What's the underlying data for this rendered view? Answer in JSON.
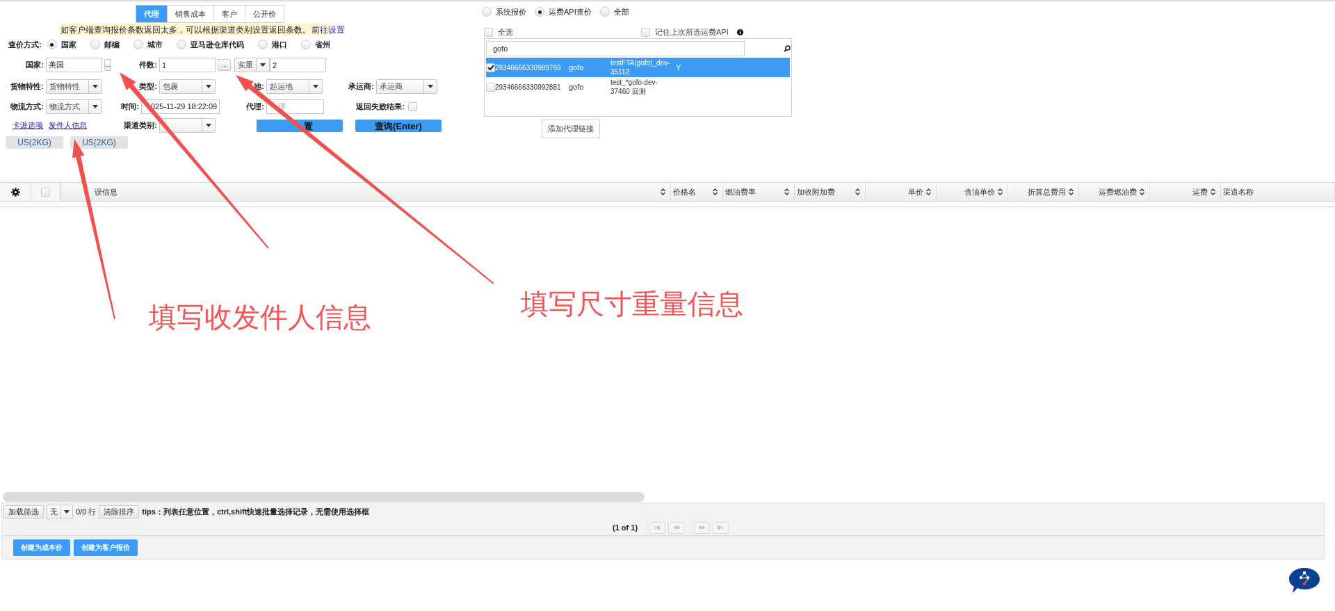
{
  "tabs": [
    {
      "label": "代理",
      "selected": true
    },
    {
      "label": "销售成本",
      "selected": false
    },
    {
      "label": "客户",
      "selected": false
    },
    {
      "label": "公开价",
      "selected": false
    }
  ],
  "notice": {
    "text": "如客户端查询报价条数返回太多，可以根据渠道类别设置返回条数。",
    "link": "前往设置"
  },
  "query_mode": {
    "label": "查价方式:",
    "options": [
      {
        "label": "国家",
        "selected": true
      },
      {
        "label": "邮编",
        "selected": false
      },
      {
        "label": "城市",
        "selected": false
      },
      {
        "label": "亚马逊仓库代码",
        "selected": false
      },
      {
        "label": "港口",
        "selected": false
      },
      {
        "label": "省州",
        "selected": false
      }
    ]
  },
  "form_rows": [
    [
      {
        "kind": "picker",
        "label": "国家:",
        "value": "美国",
        "button": "..."
      },
      {
        "kind": "picker",
        "label": "件数:",
        "value": "1",
        "button": "..."
      },
      {
        "kind": "select_input",
        "select": "实重",
        "value": "2"
      }
    ],
    [
      {
        "kind": "select",
        "label": "货物特性:",
        "value": "货物特性"
      },
      {
        "kind": "select",
        "label": "类型:",
        "value": "包裹"
      },
      {
        "kind": "select",
        "label": "地:",
        "value": "起运地"
      },
      {
        "kind": "select",
        "label": "承运商:",
        "value": "承运商"
      }
    ],
    [
      {
        "kind": "select",
        "label": "物流方式:",
        "value": "物流方式"
      },
      {
        "kind": "datetime",
        "label": "时间:",
        "value": "025-11-29 18:22:09"
      },
      {
        "kind": "input",
        "label": "代理:",
        "placeholder": "理"
      },
      {
        "kind": "checkbox",
        "label": "返回失败结果:",
        "checked": false
      }
    ],
    [
      {
        "kind": "links",
        "links": [
          "卡派选项",
          "发件人信息"
        ]
      },
      {
        "kind": "select",
        "label": "渠道类别:"
      },
      {
        "kind": "button",
        "label": "置"
      },
      {
        "kind": "button",
        "label": "查询(Enter)"
      }
    ]
  ],
  "chips": [
    "US(2KG)",
    "US(2KG)"
  ],
  "source_options": [
    {
      "label": "系统报价",
      "selected": false
    },
    {
      "label": "运费API查价",
      "selected": true
    },
    {
      "label": "全部",
      "selected": false
    }
  ],
  "select_all": {
    "label": "全选",
    "checked": false
  },
  "remember": {
    "label": "记住上次所选运费API",
    "checked": false
  },
  "api_search": {
    "value": "gofo"
  },
  "api_rows": [
    {
      "id": "29346666330989769",
      "name": "gofo",
      "channel": "testFTA(gofo)_dev-35112",
      "flag": "Y",
      "checked": true,
      "selected": true
    },
    {
      "id": "29346666330992881",
      "name": "gofo",
      "channel": "test_*gofo-dev-37460 回测",
      "checked": false,
      "selected": false
    }
  ],
  "add_button": "添加代理链接",
  "table": {
    "header_checkbox": {
      "checked": false
    },
    "columns": [
      {
        "label": "误信息"
      },
      {
        "label": "价格名"
      },
      {
        "label": "燃油费率"
      },
      {
        "label": "加收附加费"
      },
      {
        "label": "单价"
      },
      {
        "label": "含油单价"
      },
      {
        "label": "折算总费用"
      },
      {
        "label": "运费燃油费"
      },
      {
        "label": "运费"
      },
      {
        "label": "渠道名称"
      }
    ]
  },
  "toolbar": {
    "filter_button": "加载筛选",
    "filter_select": "无",
    "row_count": "0/0 行",
    "clear_sort": "清除排序",
    "tips": "tips：列表任意位置，ctrl,shift快速批量选择记录，无需使用选择框"
  },
  "pager": {
    "text": "(1 of 1)"
  },
  "actions": [
    "创建为成本价",
    "创建为客户报价"
  ],
  "annotations": [
    {
      "text": "填写收发件人信息"
    },
    {
      "text": "填写尺寸重量信息"
    }
  ]
}
